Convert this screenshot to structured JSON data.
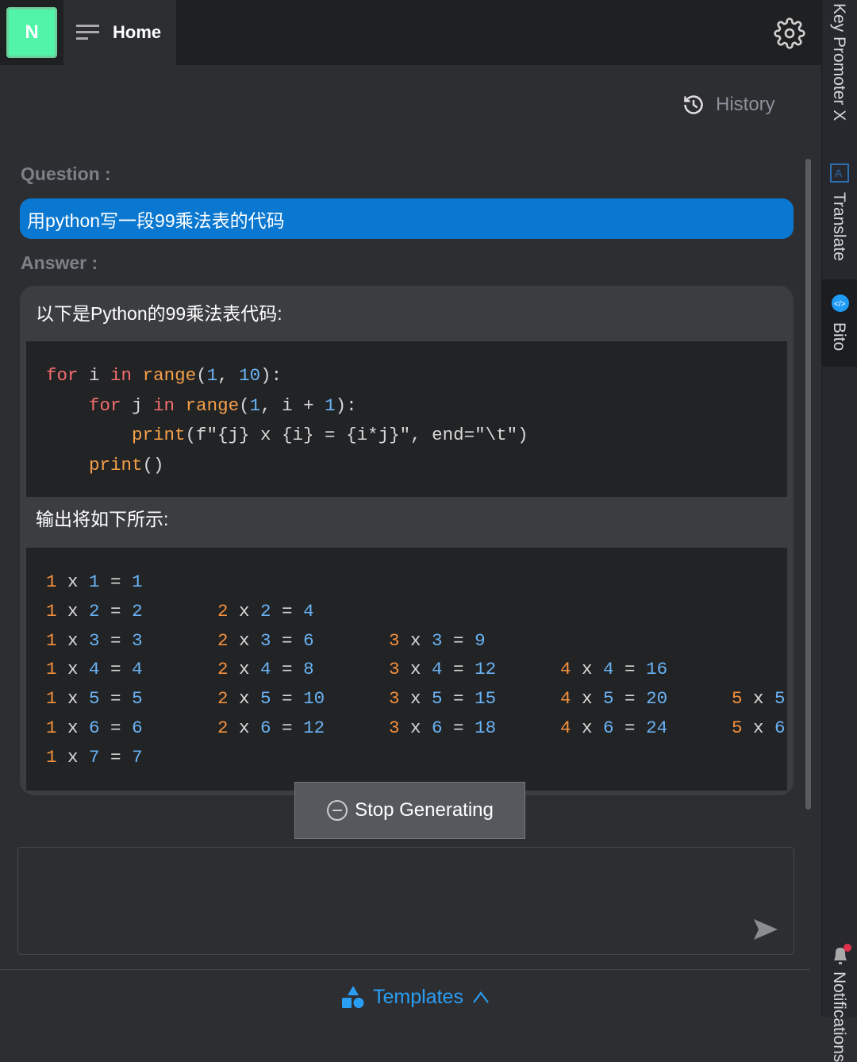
{
  "header": {
    "logo_letter": "N",
    "home_label": "Home",
    "settings_icon": "gear-icon",
    "menu_icon": "menu-icon"
  },
  "history": {
    "label": "History",
    "icon": "history-icon"
  },
  "question": {
    "label": "Question :",
    "text": "用python写一段99乘法表的代码"
  },
  "answer": {
    "label": "Answer :",
    "intro": "以下是Python的99乘法表代码:",
    "code_lines": [
      [
        [
          "for",
          "kw"
        ],
        [
          " i ",
          "tx"
        ],
        [
          "in",
          "kw"
        ],
        [
          " ",
          "tx"
        ],
        [
          "range",
          "fn"
        ],
        [
          "(",
          "tx"
        ],
        [
          "1",
          "num"
        ],
        [
          ", ",
          "tx"
        ],
        [
          "10",
          "num"
        ],
        [
          "):",
          "tx"
        ]
      ],
      [
        [
          "    for",
          "kw"
        ],
        [
          " j ",
          "tx"
        ],
        [
          "in",
          "kw"
        ],
        [
          " ",
          "tx"
        ],
        [
          "range",
          "fn"
        ],
        [
          "(",
          "tx"
        ],
        [
          "1",
          "num"
        ],
        [
          ", i + ",
          "tx"
        ],
        [
          "1",
          "num"
        ],
        [
          "):",
          "tx"
        ]
      ],
      [
        [
          "        print",
          "fn"
        ],
        [
          "(f\"{j} x {i} = {i*j}\", end=\"\\t\")",
          "tx"
        ]
      ],
      [
        [
          "    print",
          "fn"
        ],
        [
          "()",
          "tx"
        ]
      ]
    ],
    "output_intro": "输出将如下所示:",
    "output_rows": [
      [
        "1 x 1 = 1"
      ],
      [
        "1 x 2 = 2",
        "2 x 2 = 4"
      ],
      [
        "1 x 3 = 3",
        "2 x 3 = 6",
        "3 x 3 = 9"
      ],
      [
        "1 x 4 = 4",
        "2 x 4 = 8",
        "3 x 4 = 12",
        "4 x 4 = 16"
      ],
      [
        "1 x 5 = 5",
        "2 x 5 = 10",
        "3 x 5 = 15",
        "4 x 5 = 20",
        "5 x 5"
      ],
      [
        "1 x 6 = 6",
        "2 x 6 = 12",
        "3 x 6 = 18",
        "4 x 6 = 24",
        "5 x 6"
      ],
      [
        "1 x 7 = 7"
      ]
    ]
  },
  "stop_button": {
    "label": "Stop Generating",
    "icon": "minus-circle-icon"
  },
  "input": {
    "placeholder": "",
    "send_icon": "send-icon"
  },
  "templates": {
    "label": "Templates",
    "icon": "shapes-icon",
    "chevron": "chevron-up-icon"
  },
  "right_sidebar": {
    "items": [
      "Key Promoter X",
      "Translate",
      "Bito",
      "Notifications"
    ]
  },
  "colors": {
    "accent": "#0a78d0",
    "logo": "#52f5a8",
    "link": "#2a9df4"
  }
}
